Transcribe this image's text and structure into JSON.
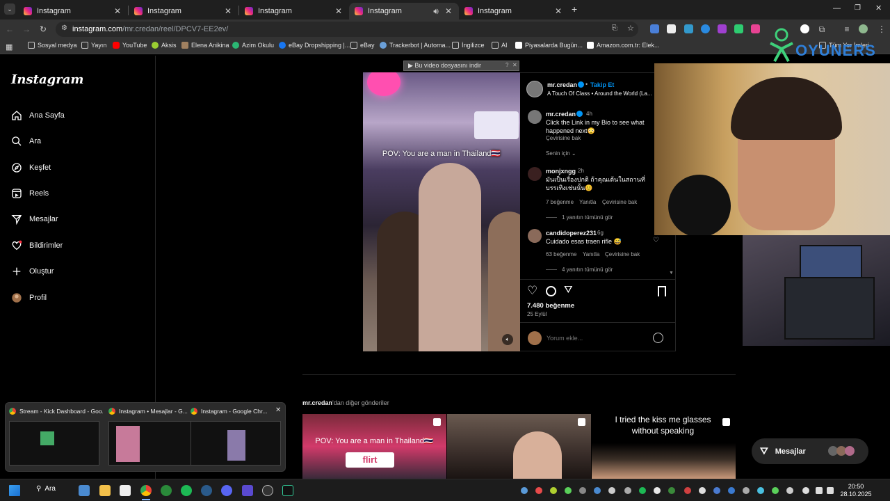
{
  "browser": {
    "tabs": [
      {
        "label": "Instagram",
        "active": false
      },
      {
        "label": "Instagram",
        "active": false
      },
      {
        "label": "Instagram",
        "active": false
      },
      {
        "label": "Instagram",
        "active": true
      },
      {
        "label": "Instagram",
        "active": false
      }
    ],
    "new_tab_glyph": "+",
    "url_host": "instagram.com",
    "url_path": "/mr.credan/reel/DPCV7-EE2ev/",
    "bookmarks": [
      {
        "label": "Sosyal medya",
        "icon": "folder-icon"
      },
      {
        "label": "Yayın",
        "icon": "folder-icon"
      },
      {
        "label": "YouTube",
        "icon": "youtube-icon",
        "color": "#ff0000"
      },
      {
        "label": "Aksis",
        "icon": "aksis-icon",
        "color": "#9acd32"
      },
      {
        "label": "Elena Anikina",
        "icon": "image-icon",
        "color": "#a08060"
      },
      {
        "label": "Azim Okulu",
        "icon": "azim-icon",
        "color": "#2bb673"
      },
      {
        "label": "eBay Dropshipping |...",
        "icon": "facebook-icon",
        "color": "#1877f2"
      },
      {
        "label": "eBay",
        "icon": "folder-icon"
      },
      {
        "label": "Trackerbot | Automa...",
        "icon": "trackerbot-icon",
        "color": "#6a9fd8"
      },
      {
        "label": "İngilizce",
        "icon": "folder-icon"
      },
      {
        "label": "AI",
        "icon": "folder-icon"
      },
      {
        "label": "Piyasalarda Bugün...",
        "icon": "news-icon",
        "color": "#ffffff"
      },
      {
        "label": "Amazon.com.tr: Elek...",
        "icon": "amazon-icon",
        "color": "#ffffff"
      }
    ],
    "bookmarks_overflow": "Tüm Yer İmleri"
  },
  "sidebar": {
    "logo": "Instagram",
    "items": [
      {
        "label": "Ana Sayfa",
        "icon": "home-icon"
      },
      {
        "label": "Ara",
        "icon": "search-icon"
      },
      {
        "label": "Keşfet",
        "icon": "explore-icon"
      },
      {
        "label": "Reels",
        "icon": "reels-icon"
      },
      {
        "label": "Mesajlar",
        "icon": "messenger-icon"
      },
      {
        "label": "Bildirimler",
        "icon": "heart-icon"
      },
      {
        "label": "Oluştur",
        "icon": "plus-icon"
      },
      {
        "label": "Profil",
        "icon": "avatar-icon"
      }
    ]
  },
  "download_bar": {
    "label": "▶ Bu video dosyasını indir",
    "badge": "?",
    "close": "✕"
  },
  "video": {
    "caption": "POV: You are a man in Thailand🇹🇭"
  },
  "post": {
    "header_user": "mr.credan",
    "follow": "Takip Et",
    "separator": "•",
    "audio": "A Touch Of Class • Around the World (La...",
    "caption_user": "mr.credan",
    "caption_time": "4h",
    "caption_text": "Click the Link in my Bio to see what happened next😳",
    "translate": "Çevirisine bak",
    "sort_label": "Senin için",
    "comments": [
      {
        "user": "monjxngg",
        "time": "2h",
        "text": "มันเป็นเรื่องปกติ ถ้าคุณเต้นในสถานที่บรรเทิงเช่นนั้น😊",
        "likes": "7 beğenme",
        "reply": "Yanıtla",
        "translate": "Çevirisine bak",
        "replies": "1 yanıtın tümünü gör"
      },
      {
        "user": "candidoperez231",
        "time": "6g",
        "text": "Cuidado esas traen rifle 😅",
        "likes": "63 beğenme",
        "reply": "Yanıtla",
        "translate": "Çevirisine bak",
        "replies": "4 yanıtın tümünü gör"
      }
    ],
    "likes_total": "7.480 beğenme",
    "date": "25 Eylül",
    "comment_placeholder": "Yorum ekle..."
  },
  "more": {
    "user": "mr.credan",
    "suffix": "'dan diğer gönderiler",
    "thumbs": [
      {
        "caption": "POV: You are a man in Thailand🇹🇭",
        "sign": "flirt"
      },
      {
        "caption": ""
      },
      {
        "caption": "I tried the kiss me glasses without speaking"
      }
    ]
  },
  "messages_button": {
    "label": "Mesajlar"
  },
  "taskbar_preview": [
    {
      "title": "Stream - Kick Dashboard - Goo..."
    },
    {
      "title": "Instagram • Mesajlar - G..."
    },
    {
      "title": "Instagram - Google Chr..."
    }
  ],
  "preview_close": "✕",
  "taskbar": {
    "search_label": "Ara",
    "time": "20:50",
    "date": "28.10.2025"
  },
  "overlay_logo_text": "OYUNERS",
  "colors": {
    "accent_blue": "#0095f6",
    "instagram_gradient": [
      "#f9ce34",
      "#ee2a7b",
      "#6228d7"
    ],
    "notification_dot": "#ff3040"
  }
}
